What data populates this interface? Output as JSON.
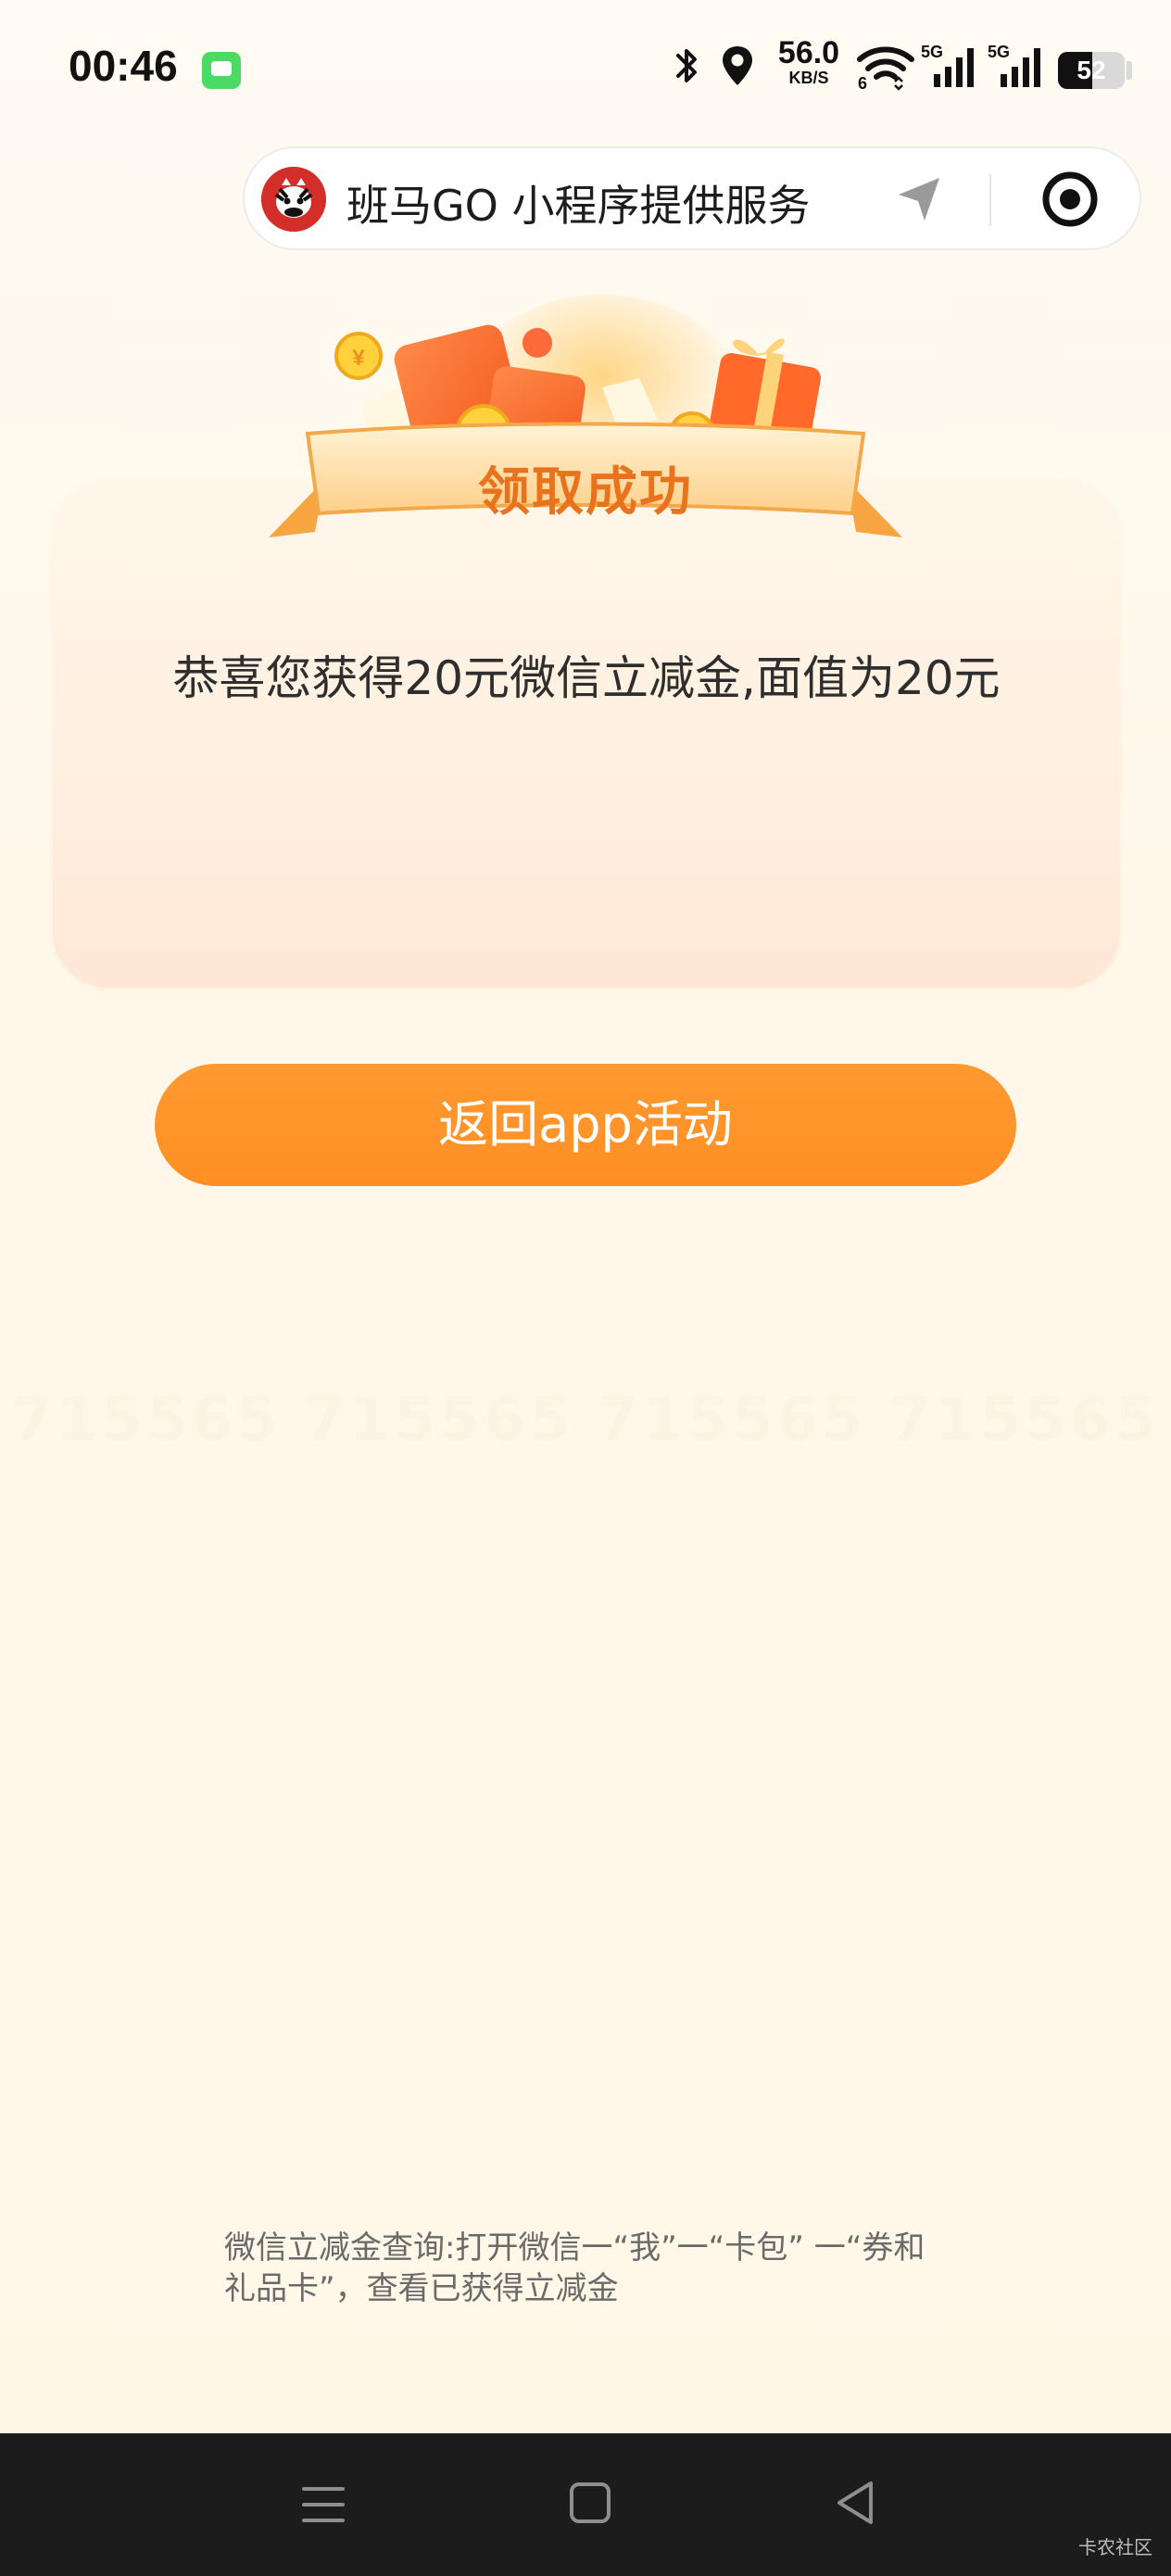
{
  "status_bar": {
    "time": "00:46",
    "net_speed": "56.0",
    "net_speed_unit": "KB/S",
    "signal_1_label": "5G",
    "signal_2_label": "5G",
    "wifi_badge": "6",
    "battery_level": "52",
    "battery_percent": 52
  },
  "capsule": {
    "title": "班马GO 小程序提供服务"
  },
  "banner": {
    "title": "领取成功"
  },
  "card": {
    "message": "恭喜您获得20元微信立减金,面值为20元"
  },
  "actions": {
    "return_label": "返回app活动"
  },
  "watermark": {
    "text": "715565"
  },
  "footer": {
    "note_line1": "微信立减金查询:打开微信一“我”一“卡包” 一“券和",
    "note_line2": "礼品卡”，查看已获得立减金"
  },
  "corner": {
    "label": "卡农社区"
  },
  "colors": {
    "accent": "#ff8f24",
    "banner_text": "#e9721c",
    "nav_bar": "#1c1c1c"
  }
}
